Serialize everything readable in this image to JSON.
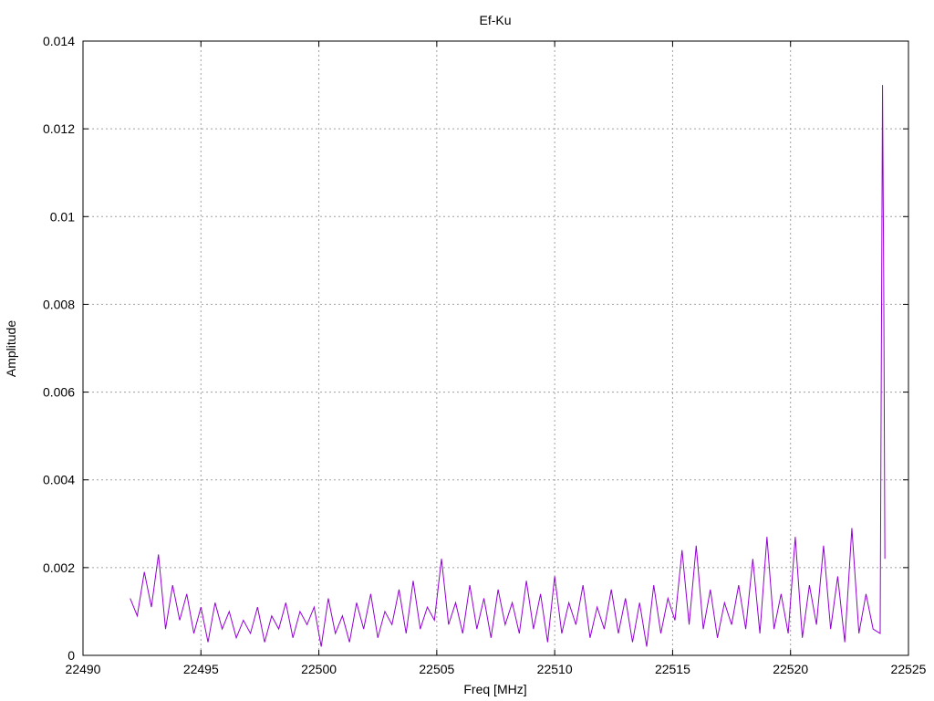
{
  "chart_data": {
    "type": "line",
    "title": "Ef-Ku",
    "xlabel": "Freq [MHz]",
    "ylabel": "Amplitude",
    "xlim": [
      22490,
      22525
    ],
    "ylim": [
      0,
      0.014
    ],
    "x_ticks": [
      "22490",
      "22495",
      "22500",
      "22505",
      "22510",
      "22515",
      "22520",
      "22525"
    ],
    "y_ticks": [
      "0",
      "0.002",
      "0.004",
      "0.006",
      "0.008",
      "0.01",
      "0.012",
      "0.014"
    ],
    "grid": true,
    "legend": "none",
    "series": [
      {
        "color": "#9400d3",
        "x": [
          22492.0,
          22492.3,
          22492.6,
          22492.9,
          22493.2,
          22493.5,
          22493.8,
          22494.1,
          22494.4,
          22494.7,
          22495.0,
          22495.3,
          22495.6,
          22495.9,
          22496.2,
          22496.5,
          22496.8,
          22497.1,
          22497.4,
          22497.7,
          22498.0,
          22498.3,
          22498.6,
          22498.9,
          22499.2,
          22499.5,
          22499.8,
          22500.1,
          22500.4,
          22500.7,
          22501.0,
          22501.3,
          22501.6,
          22501.9,
          22502.2,
          22502.5,
          22502.8,
          22503.1,
          22503.4,
          22503.7,
          22504.0,
          22504.3,
          22504.6,
          22504.9,
          22505.2,
          22505.5,
          22505.8,
          22506.1,
          22506.4,
          22506.7,
          22507.0,
          22507.3,
          22507.6,
          22507.9,
          22508.2,
          22508.5,
          22508.8,
          22509.1,
          22509.4,
          22509.7,
          22510.0,
          22510.3,
          22510.6,
          22510.9,
          22511.2,
          22511.5,
          22511.8,
          22512.1,
          22512.4,
          22512.7,
          22513.0,
          22513.3,
          22513.6,
          22513.9,
          22514.2,
          22514.5,
          22514.8,
          22515.1,
          22515.4,
          22515.7,
          22516.0,
          22516.3,
          22516.6,
          22516.9,
          22517.2,
          22517.5,
          22517.8,
          22518.1,
          22518.4,
          22518.7,
          22519.0,
          22519.3,
          22519.6,
          22519.9,
          22520.2,
          22520.5,
          22520.8,
          22521.1,
          22521.4,
          22521.7,
          22522.0,
          22522.3,
          22522.6,
          22522.9,
          22523.2,
          22523.5,
          22523.8,
          22523.9,
          22523.95,
          22524.0
        ],
        "y": [
          0.0013,
          0.0009,
          0.0019,
          0.0011,
          0.0023,
          0.0006,
          0.0016,
          0.0008,
          0.0014,
          0.0005,
          0.0011,
          0.0003,
          0.0012,
          0.0006,
          0.001,
          0.0004,
          0.0008,
          0.0005,
          0.0011,
          0.0003,
          0.0009,
          0.0006,
          0.0012,
          0.0004,
          0.001,
          0.0007,
          0.0011,
          0.0002,
          0.0013,
          0.0005,
          0.0009,
          0.0003,
          0.0012,
          0.0006,
          0.0014,
          0.0004,
          0.001,
          0.0007,
          0.0015,
          0.0005,
          0.0017,
          0.0006,
          0.0011,
          0.0008,
          0.0022,
          0.0007,
          0.0012,
          0.0005,
          0.0016,
          0.0006,
          0.0013,
          0.0004,
          0.0015,
          0.0007,
          0.0012,
          0.0005,
          0.0017,
          0.0006,
          0.0014,
          0.0003,
          0.0018,
          0.0005,
          0.0012,
          0.0007,
          0.0016,
          0.0004,
          0.0011,
          0.0006,
          0.0015,
          0.0005,
          0.0013,
          0.0003,
          0.0012,
          0.0002,
          0.0016,
          0.0005,
          0.0013,
          0.0008,
          0.0024,
          0.0007,
          0.0025,
          0.0006,
          0.0015,
          0.0004,
          0.0012,
          0.0007,
          0.0016,
          0.0006,
          0.0022,
          0.0005,
          0.0027,
          0.0006,
          0.0014,
          0.0005,
          0.0027,
          0.0004,
          0.0016,
          0.0007,
          0.0025,
          0.0006,
          0.0018,
          0.0003,
          0.0029,
          0.0005,
          0.0014,
          0.0006,
          0.0005,
          0.013,
          0.0086,
          0.0022
        ]
      }
    ]
  }
}
